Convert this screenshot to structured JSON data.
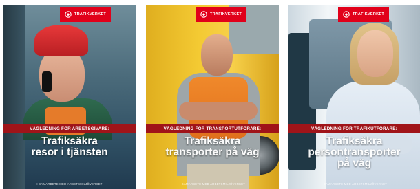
{
  "cards": [
    {
      "brand": "TRAFIKVERKET",
      "banner": "VÄGLEDNING FÖR ARBETSGIVARE:",
      "title_line1": "Trafiksäkra",
      "title_line2": "resor i tjänsten",
      "footer": "I SAMARBETE MED ARBETSMILJÖVERKET"
    },
    {
      "brand": "TRAFIKVERKET",
      "banner": "VÄGLEDNING FÖR TRANSPORTUTFÖRARE:",
      "title_line1": "Trafiksäkra",
      "title_line2": "transporter på väg",
      "footer": "I SAMARBETE MED ARBETSMILJÖVERKET"
    },
    {
      "brand": "TRAFIKVERKET",
      "banner": "VÄGLEDNING FÖR TRAFIKUTFÖRARE:",
      "title_line1": "Trafiksäkra",
      "title_line2": "persontransporter",
      "title_line3": "på väg",
      "footer": "I SAMARBETE MED ARBETSMILJÖVERKET"
    }
  ],
  "colors": {
    "brand_red": "#e1001a",
    "banner_red": "#a01419"
  }
}
